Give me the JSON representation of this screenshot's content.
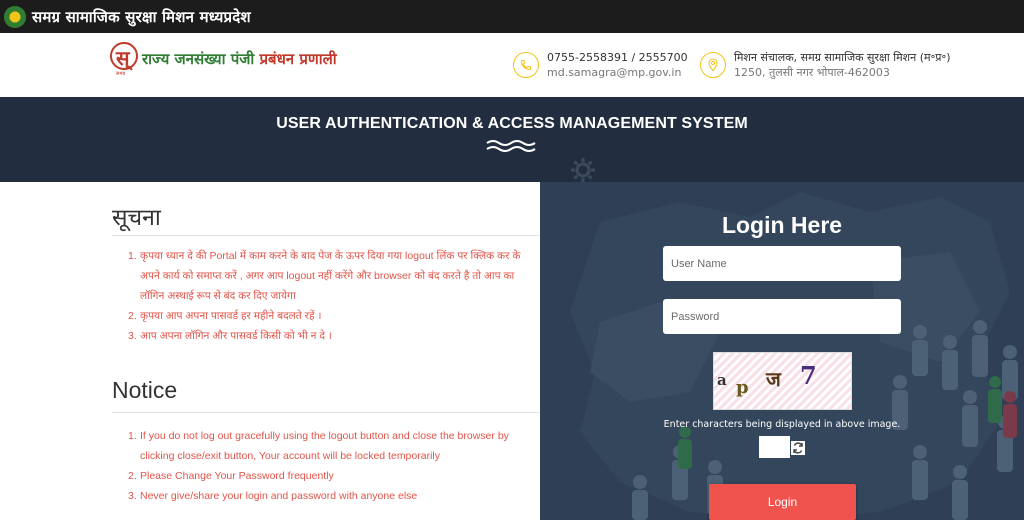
{
  "topbar": {
    "title": "समग्र सामाजिक सुरक्षा मिशन मध्यप्रदेश"
  },
  "header": {
    "logo_text_1": "राज्य जनसंख्या पंजी ",
    "logo_text_2": "प्रबंधन प्रणाली",
    "logo_sub": "समग्र",
    "phone": "0755-2558391 / 2555700",
    "email": "md.samagra@mp.gov.in",
    "address_title": "मिशन संचालक, समग्र सामाजिक सुरक्षा मिशन (म॰प्र॰)",
    "address": "1250, तुलसी नगर भोपाल-462003"
  },
  "banner": {
    "title": "USER AUTHENTICATION & ACCESS MANAGEMENT SYSTEM"
  },
  "notice_hi": {
    "title": "सूचना",
    "items": [
      "कृपया ध्यान दे की Portal में काम करने के बाद पेज के ऊपर दिया गया logout लिंक पर क्लिक कर के अपने कार्य को समाप्त करें , अगर आप logout नहीं करेंगे और browser को बंद करते है तो आप का लॉगिन अस्थाई रूप से बंद कर दिए जायेगा",
      "कृपया आप अपना पासवर्ड हर महीने बदलते रहें ।",
      "आप अपना लॉगिन और पासवर्ड किसी को भी न दे ।"
    ]
  },
  "notice_en": {
    "title": "Notice",
    "items": [
      "If you do not log out gracefully using the logout button and close the browser by clicking close/exit button, Your account will be locked temporarily",
      "Please Change Your Password frequently",
      "Never give/share your login and password with anyone else"
    ]
  },
  "login": {
    "title": "Login Here",
    "username_placeholder": "User Name",
    "password_placeholder": "Password",
    "captcha_chars": [
      "a",
      "p",
      "ज",
      "7"
    ],
    "captcha_hint": "Enter characters being displayed in above image.",
    "button_label": "Login"
  },
  "colors": {
    "accent": "#f0524e",
    "notice_text": "#e0554a",
    "banner_bg": "#222d3f"
  }
}
